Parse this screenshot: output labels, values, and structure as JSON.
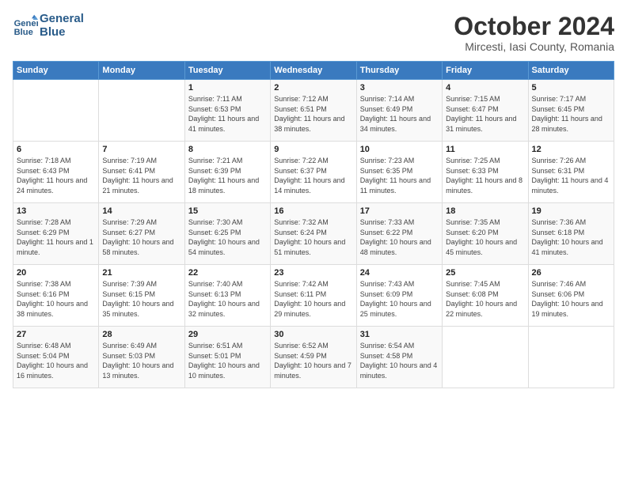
{
  "header": {
    "logo_line1": "General",
    "logo_line2": "Blue",
    "month": "October 2024",
    "location": "Mircesti, Iasi County, Romania"
  },
  "weekdays": [
    "Sunday",
    "Monday",
    "Tuesday",
    "Wednesday",
    "Thursday",
    "Friday",
    "Saturday"
  ],
  "weeks": [
    [
      {
        "day": "",
        "info": ""
      },
      {
        "day": "",
        "info": ""
      },
      {
        "day": "1",
        "info": "Sunrise: 7:11 AM\nSunset: 6:53 PM\nDaylight: 11 hours and 41 minutes."
      },
      {
        "day": "2",
        "info": "Sunrise: 7:12 AM\nSunset: 6:51 PM\nDaylight: 11 hours and 38 minutes."
      },
      {
        "day": "3",
        "info": "Sunrise: 7:14 AM\nSunset: 6:49 PM\nDaylight: 11 hours and 34 minutes."
      },
      {
        "day": "4",
        "info": "Sunrise: 7:15 AM\nSunset: 6:47 PM\nDaylight: 11 hours and 31 minutes."
      },
      {
        "day": "5",
        "info": "Sunrise: 7:17 AM\nSunset: 6:45 PM\nDaylight: 11 hours and 28 minutes."
      }
    ],
    [
      {
        "day": "6",
        "info": "Sunrise: 7:18 AM\nSunset: 6:43 PM\nDaylight: 11 hours and 24 minutes."
      },
      {
        "day": "7",
        "info": "Sunrise: 7:19 AM\nSunset: 6:41 PM\nDaylight: 11 hours and 21 minutes."
      },
      {
        "day": "8",
        "info": "Sunrise: 7:21 AM\nSunset: 6:39 PM\nDaylight: 11 hours and 18 minutes."
      },
      {
        "day": "9",
        "info": "Sunrise: 7:22 AM\nSunset: 6:37 PM\nDaylight: 11 hours and 14 minutes."
      },
      {
        "day": "10",
        "info": "Sunrise: 7:23 AM\nSunset: 6:35 PM\nDaylight: 11 hours and 11 minutes."
      },
      {
        "day": "11",
        "info": "Sunrise: 7:25 AM\nSunset: 6:33 PM\nDaylight: 11 hours and 8 minutes."
      },
      {
        "day": "12",
        "info": "Sunrise: 7:26 AM\nSunset: 6:31 PM\nDaylight: 11 hours and 4 minutes."
      }
    ],
    [
      {
        "day": "13",
        "info": "Sunrise: 7:28 AM\nSunset: 6:29 PM\nDaylight: 11 hours and 1 minute."
      },
      {
        "day": "14",
        "info": "Sunrise: 7:29 AM\nSunset: 6:27 PM\nDaylight: 10 hours and 58 minutes."
      },
      {
        "day": "15",
        "info": "Sunrise: 7:30 AM\nSunset: 6:25 PM\nDaylight: 10 hours and 54 minutes."
      },
      {
        "day": "16",
        "info": "Sunrise: 7:32 AM\nSunset: 6:24 PM\nDaylight: 10 hours and 51 minutes."
      },
      {
        "day": "17",
        "info": "Sunrise: 7:33 AM\nSunset: 6:22 PM\nDaylight: 10 hours and 48 minutes."
      },
      {
        "day": "18",
        "info": "Sunrise: 7:35 AM\nSunset: 6:20 PM\nDaylight: 10 hours and 45 minutes."
      },
      {
        "day": "19",
        "info": "Sunrise: 7:36 AM\nSunset: 6:18 PM\nDaylight: 10 hours and 41 minutes."
      }
    ],
    [
      {
        "day": "20",
        "info": "Sunrise: 7:38 AM\nSunset: 6:16 PM\nDaylight: 10 hours and 38 minutes."
      },
      {
        "day": "21",
        "info": "Sunrise: 7:39 AM\nSunset: 6:15 PM\nDaylight: 10 hours and 35 minutes."
      },
      {
        "day": "22",
        "info": "Sunrise: 7:40 AM\nSunset: 6:13 PM\nDaylight: 10 hours and 32 minutes."
      },
      {
        "day": "23",
        "info": "Sunrise: 7:42 AM\nSunset: 6:11 PM\nDaylight: 10 hours and 29 minutes."
      },
      {
        "day": "24",
        "info": "Sunrise: 7:43 AM\nSunset: 6:09 PM\nDaylight: 10 hours and 25 minutes."
      },
      {
        "day": "25",
        "info": "Sunrise: 7:45 AM\nSunset: 6:08 PM\nDaylight: 10 hours and 22 minutes."
      },
      {
        "day": "26",
        "info": "Sunrise: 7:46 AM\nSunset: 6:06 PM\nDaylight: 10 hours and 19 minutes."
      }
    ],
    [
      {
        "day": "27",
        "info": "Sunrise: 6:48 AM\nSunset: 5:04 PM\nDaylight: 10 hours and 16 minutes."
      },
      {
        "day": "28",
        "info": "Sunrise: 6:49 AM\nSunset: 5:03 PM\nDaylight: 10 hours and 13 minutes."
      },
      {
        "day": "29",
        "info": "Sunrise: 6:51 AM\nSunset: 5:01 PM\nDaylight: 10 hours and 10 minutes."
      },
      {
        "day": "30",
        "info": "Sunrise: 6:52 AM\nSunset: 4:59 PM\nDaylight: 10 hours and 7 minutes."
      },
      {
        "day": "31",
        "info": "Sunrise: 6:54 AM\nSunset: 4:58 PM\nDaylight: 10 hours and 4 minutes."
      },
      {
        "day": "",
        "info": ""
      },
      {
        "day": "",
        "info": ""
      }
    ]
  ]
}
